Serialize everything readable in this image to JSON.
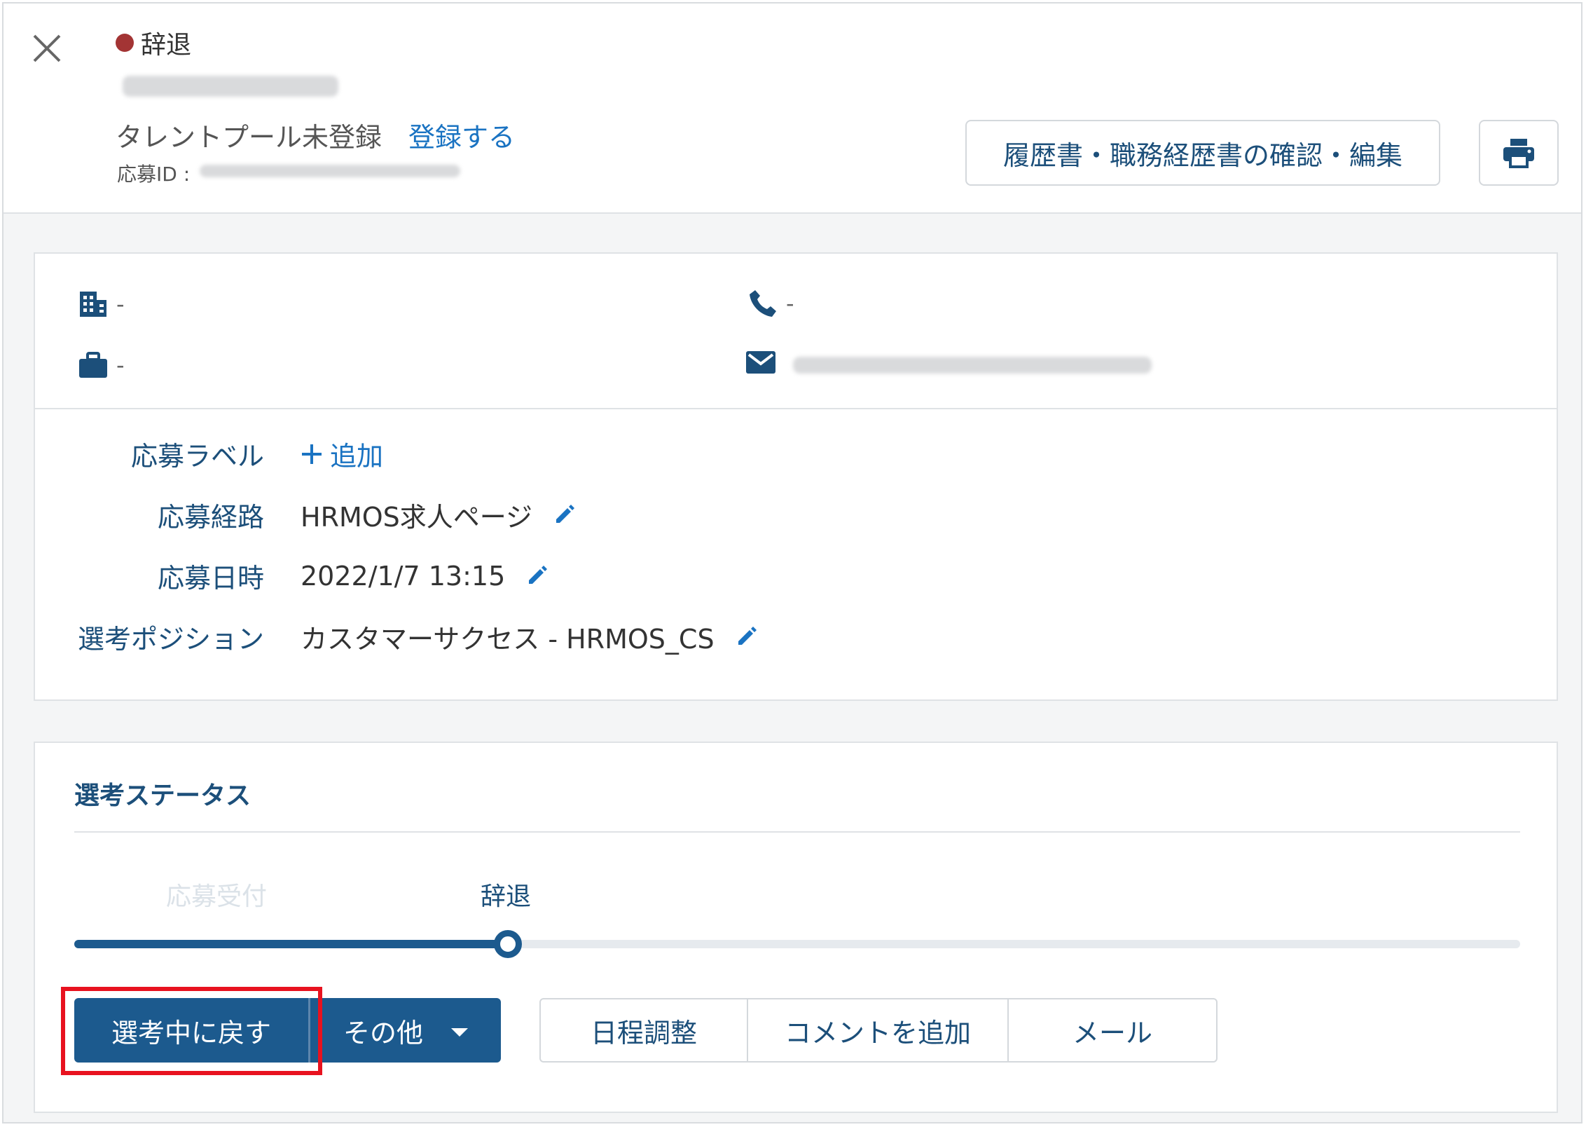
{
  "header": {
    "status": "辞退",
    "status_color": "#a33434",
    "talent_pool_text": "タレントプール未登録",
    "register_link": "登録する",
    "application_id_label": "応募ID :",
    "resume_button": "履歴書・職務経歴書の確認・編集",
    "print_icon": "printer-icon",
    "close_icon": "close-icon"
  },
  "contact": {
    "company": "-",
    "job": "-",
    "phone": "-",
    "email_icon": "mail-icon"
  },
  "details": {
    "label_title": "応募ラベル",
    "add_label": "追加",
    "route_title": "応募経路",
    "route_value": "HRMOS求人ページ",
    "date_title": "応募日時",
    "date_value": "2022/1/7 13:15",
    "position_title": "選考ポジション",
    "position_value": "カスタマーサクセス - HRMOS_CS"
  },
  "selection_status": {
    "title": "選考ステータス",
    "step_1": "応募受付",
    "step_2": "辞退",
    "progress_ratio": 0.3
  },
  "actions": {
    "return_button": "選考中に戻す",
    "other_button": "その他",
    "schedule_button": "日程調整",
    "comment_button": "コメントを追加",
    "mail_button": "メール"
  },
  "colors": {
    "primary": "#1c5a8e",
    "link": "#1a73c2",
    "highlight": "#e8121f"
  }
}
